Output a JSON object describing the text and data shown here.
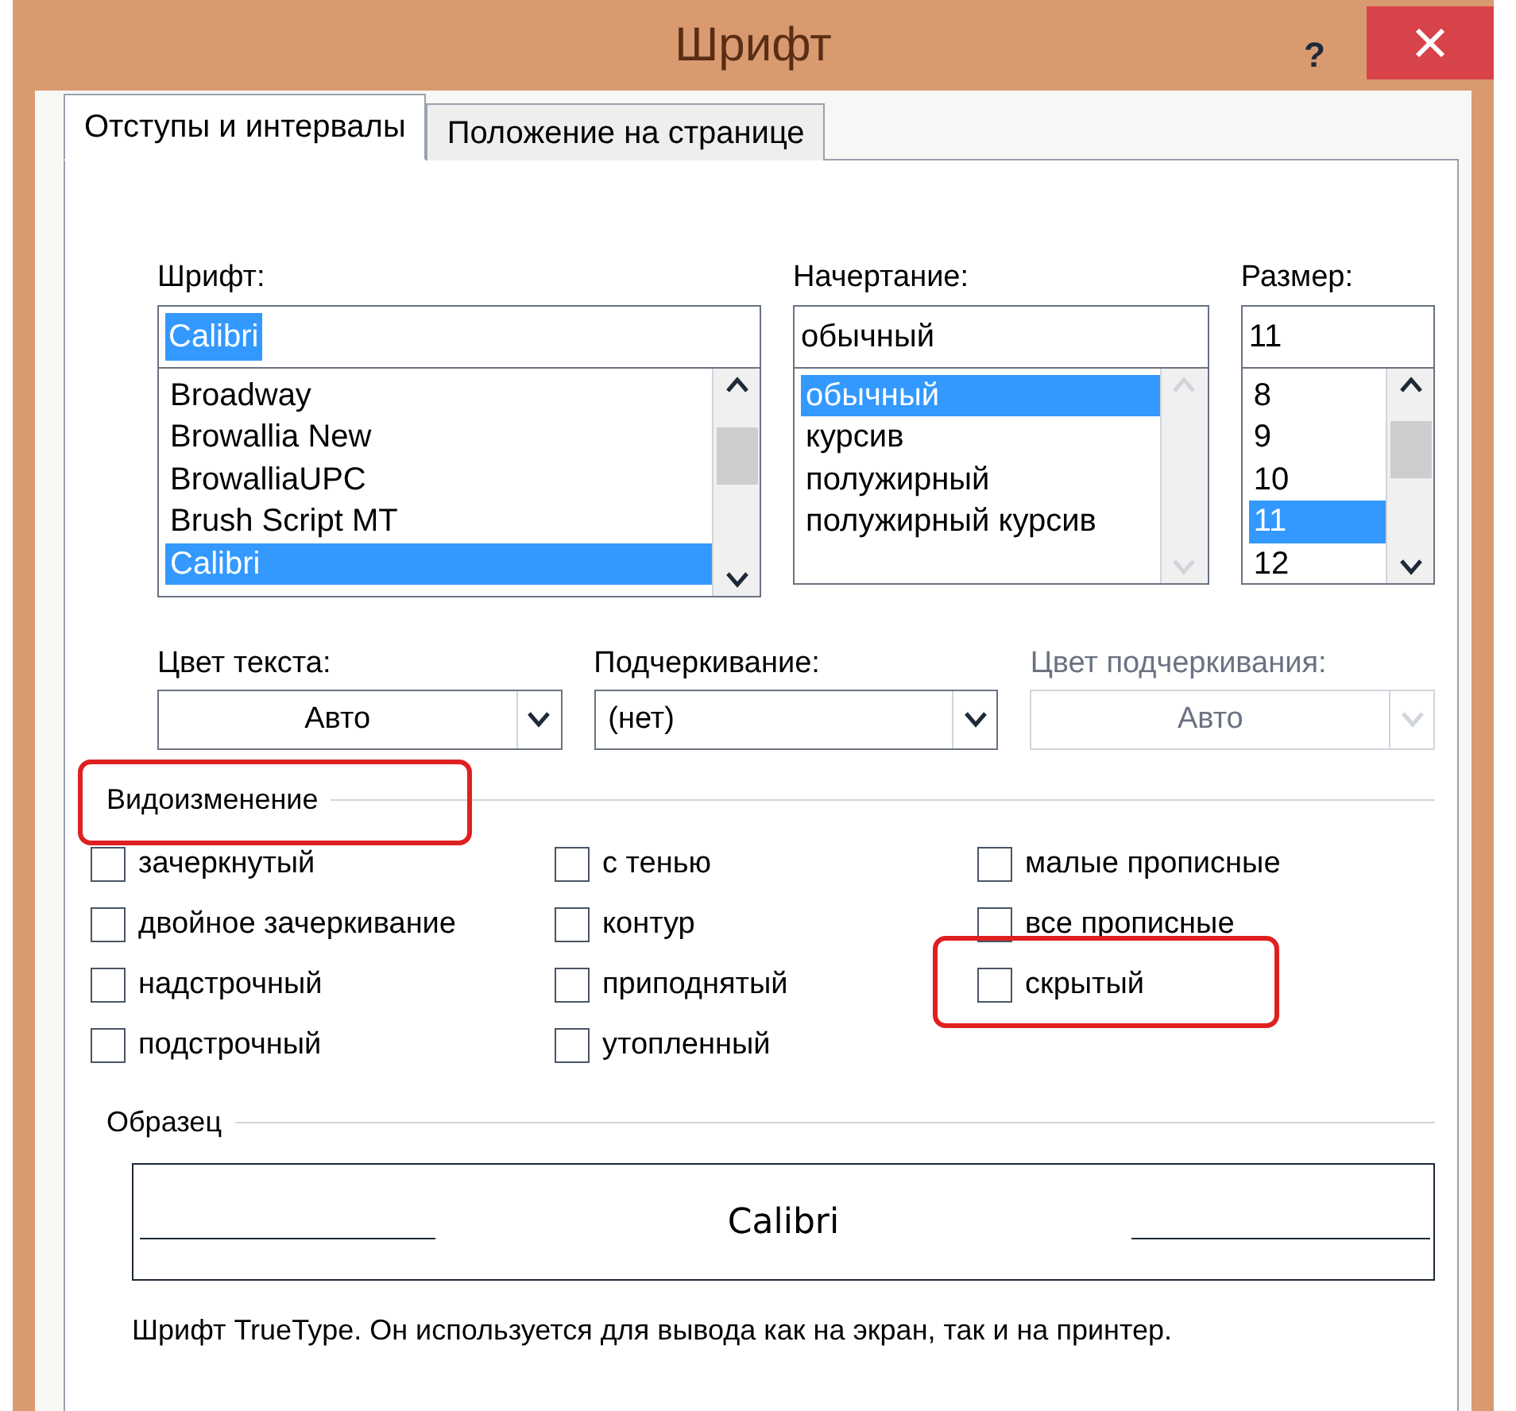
{
  "window": {
    "title": "Шрифт",
    "help": "?"
  },
  "tabs": [
    {
      "label": "Отступы и интервалы",
      "selected": true
    },
    {
      "label": "Положение на странице",
      "selected": false
    }
  ],
  "font": {
    "label": "Шрифт:",
    "value": "Calibri",
    "items": [
      {
        "text": "Broadway",
        "selected": false
      },
      {
        "text": "Browallia New",
        "selected": false
      },
      {
        "text": "BrowalliaUPC",
        "selected": false
      },
      {
        "text": "Brush Script MT",
        "selected": false
      },
      {
        "text": "Calibri",
        "selected": true
      }
    ]
  },
  "style": {
    "label": "Начертание:",
    "value": "обычный",
    "items": [
      {
        "text": "обычный",
        "selected": true
      },
      {
        "text": "курсив",
        "selected": false
      },
      {
        "text": "полужирный",
        "selected": false
      },
      {
        "text": "полужирный курсив",
        "selected": false
      }
    ]
  },
  "size": {
    "label": "Размер:",
    "value": "11",
    "items": [
      {
        "text": "8",
        "selected": false
      },
      {
        "text": "9",
        "selected": false
      },
      {
        "text": "10",
        "selected": false
      },
      {
        "text": "11",
        "selected": true
      },
      {
        "text": "12",
        "selected": false
      }
    ]
  },
  "dropdowns": [
    {
      "label": "Цвет текста:",
      "value": "Авто",
      "disabled": false,
      "centered": true
    },
    {
      "label": "Подчеркивание:",
      "value": "(нет)",
      "disabled": false,
      "centered": false
    },
    {
      "label": "Цвет подчеркивания:",
      "value": "Авто",
      "disabled": true,
      "centered": true
    }
  ],
  "effects": {
    "title": "Видоизменение",
    "highlighted": true,
    "columns": [
      [
        {
          "label": "зачеркнутый",
          "checked": false,
          "highlighted": false
        },
        {
          "label": "двойное зачеркивание",
          "checked": false,
          "highlighted": false
        },
        {
          "label": "надстрочный",
          "checked": false,
          "highlighted": false
        },
        {
          "label": "подстрочный",
          "checked": false,
          "highlighted": false
        }
      ],
      [
        {
          "label": "с тенью",
          "checked": false,
          "highlighted": false
        },
        {
          "label": "контур",
          "checked": false,
          "highlighted": false
        },
        {
          "label": "приподнятый",
          "checked": false,
          "highlighted": false
        },
        {
          "label": "утопленный",
          "checked": false,
          "highlighted": false
        }
      ],
      [
        {
          "label": "малые прописные",
          "checked": false,
          "highlighted": false
        },
        {
          "label": "все прописные",
          "checked": false,
          "highlighted": false
        },
        {
          "label": "скрытый",
          "checked": false,
          "highlighted": true
        }
      ]
    ]
  },
  "sample": {
    "title": "Образец",
    "text": "Calibri",
    "note": "Шрифт TrueType. Он используется для вывода как на экран, так и на принтер."
  }
}
